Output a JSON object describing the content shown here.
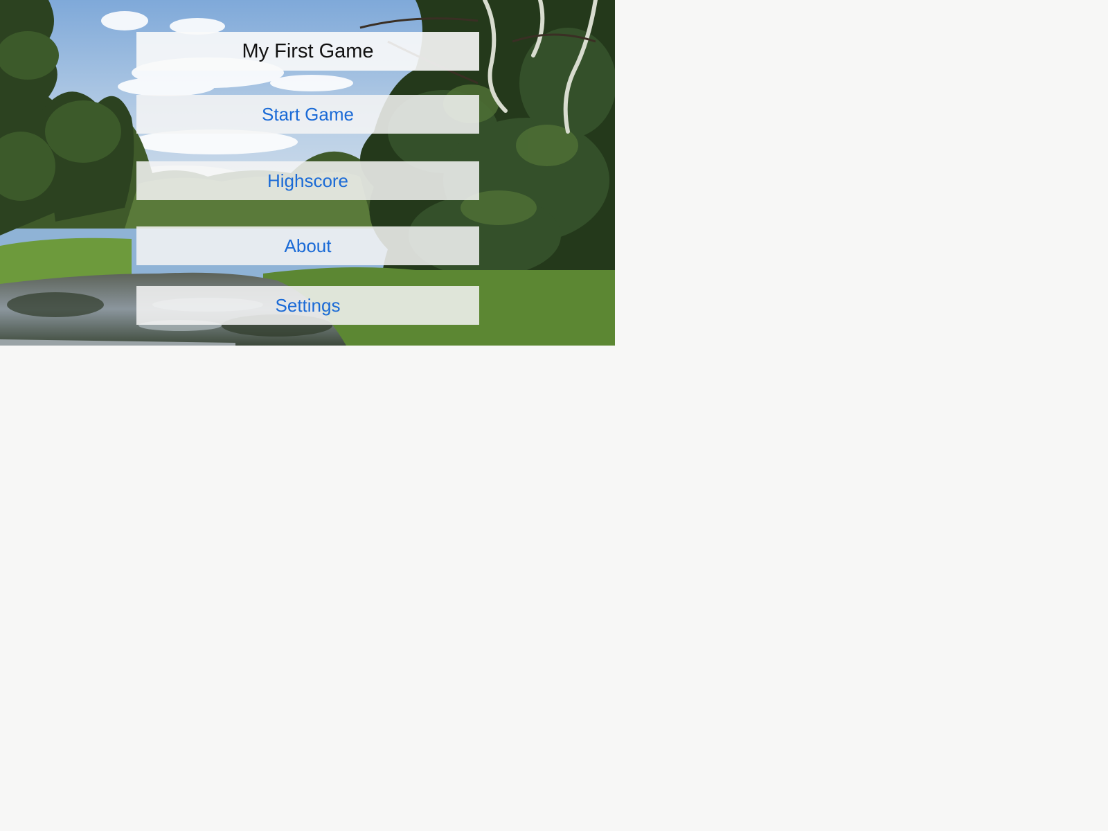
{
  "game": {
    "title": "My First Game",
    "colors": {
      "title_text": "#111111",
      "button_text": "#1a6ad6",
      "panel_background": "#f5f5f5",
      "page_background": "#f7f7f6"
    },
    "background": {
      "type": "swamp-landscape-photo"
    },
    "menu": {
      "items": [
        {
          "label": "Start Game"
        },
        {
          "label": "Highscore"
        },
        {
          "label": "About"
        },
        {
          "label": "Settings"
        }
      ]
    }
  }
}
